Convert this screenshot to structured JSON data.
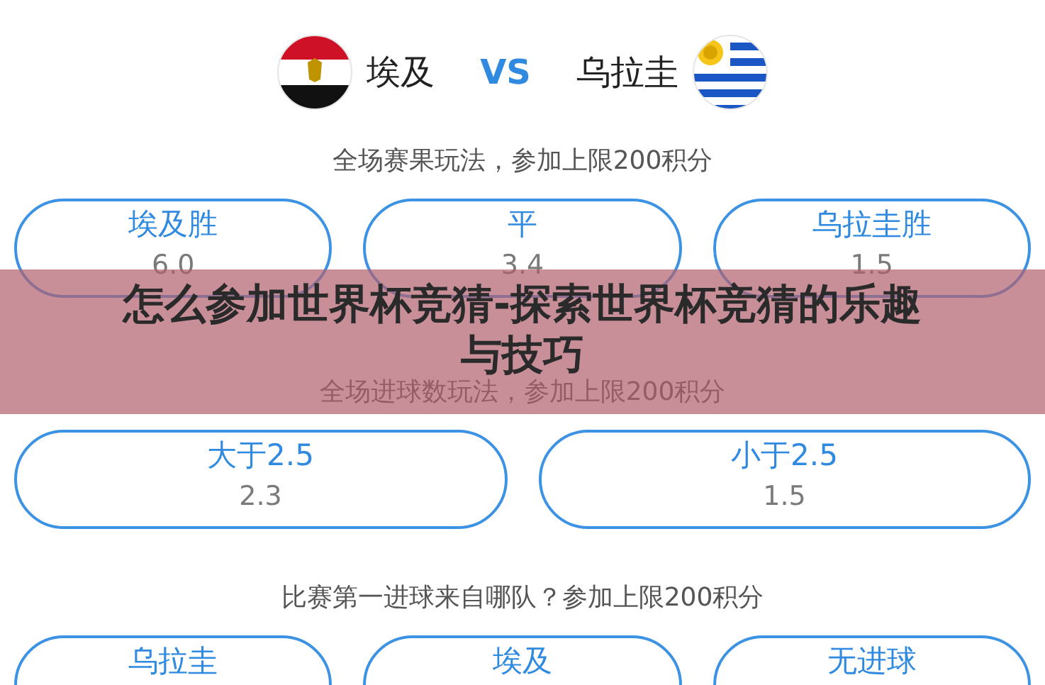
{
  "match": {
    "home": "埃及",
    "vs": "VS",
    "away": "乌拉圭"
  },
  "sections": [
    {
      "title": "全场赛果玩法，参加上限200积分",
      "options": [
        {
          "label": "埃及胜",
          "odds": "6.0"
        },
        {
          "label": "平",
          "odds": "3.4"
        },
        {
          "label": "乌拉圭胜",
          "odds": "1.5"
        }
      ]
    },
    {
      "title": "全场进球数玩法，参加上限200积分",
      "options": [
        {
          "label": "大于2.5",
          "odds": "2.3"
        },
        {
          "label": "小于2.5",
          "odds": "1.5"
        }
      ]
    },
    {
      "title": "比赛第一进球来自哪队？参加上限200积分",
      "options": [
        {
          "label": "乌拉圭"
        },
        {
          "label": "埃及"
        },
        {
          "label": "无进球"
        }
      ]
    }
  ],
  "banner": {
    "title": "怎么参加世界杯竞猜-探索世界杯竞猜的乐趣与技巧"
  }
}
